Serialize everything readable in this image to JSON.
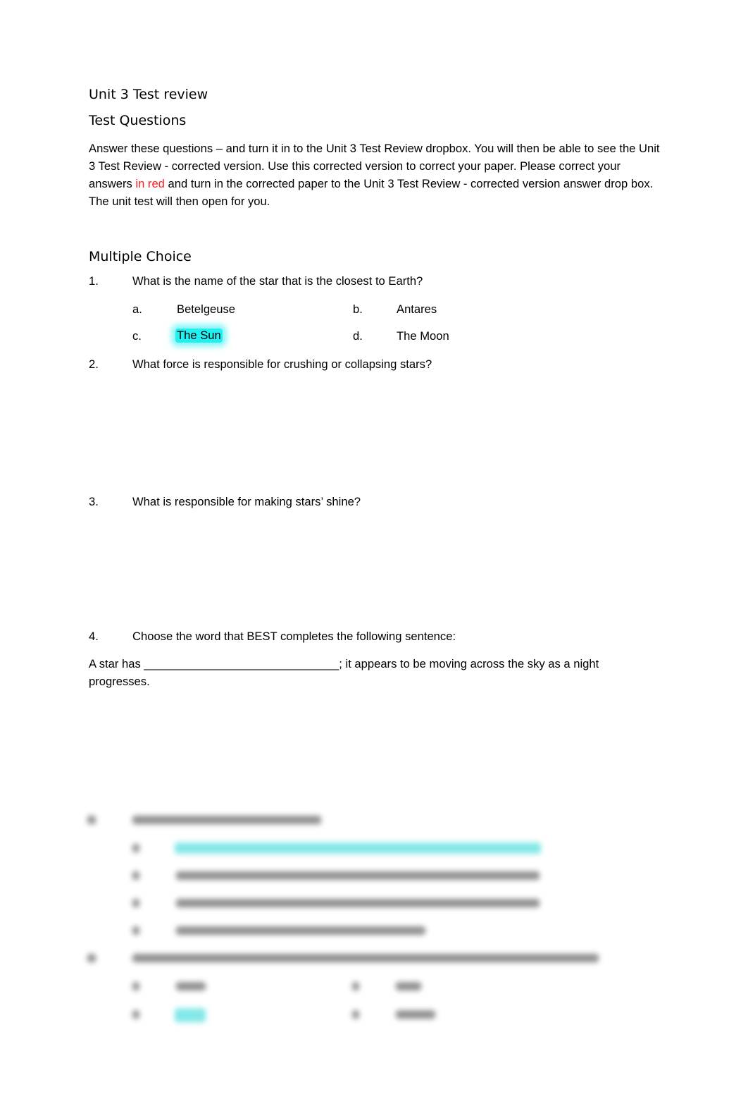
{
  "document": {
    "title": "Unit 3 Test review",
    "subtitle": "Test Questions",
    "instructions": {
      "part1": "Answer these questions – and turn it in to the Unit 3 Test Review dropbox. You will then be able to see the Unit 3 Test Review - corrected version.  Use this corrected version to correct your paper.  Please correct your answers ",
      "red_text": "in red",
      "part2": " and turn in the corrected paper to the Unit 3 Test Review - corrected version answer drop box.  The unit test will then open for you."
    },
    "section_heading": "Multiple Choice",
    "questions": [
      {
        "number": "1.",
        "text": "What is the name of the star that is the closest to Earth?",
        "options": [
          {
            "letter": "a.",
            "text": "Betelgeuse",
            "highlighted": false
          },
          {
            "letter": "b.",
            "text": "Antares",
            "highlighted": false
          },
          {
            "letter": "c.",
            "text": "The Sun",
            "highlighted": true
          },
          {
            "letter": "d.",
            "text": "The Moon",
            "highlighted": false
          }
        ]
      },
      {
        "number": "2.",
        "text": "What force is responsible for crushing or collapsing stars?"
      },
      {
        "number": "3.",
        "text": "What is responsible for making stars’ shine?"
      },
      {
        "number": "4.",
        "text": "Choose the word that BEST completes the following sentence:",
        "fill_in": {
          "before": "A star has ",
          "blank": "______________________________",
          "after": ";  it appears to be moving across the sky as a night",
          "continuation": "progresses."
        }
      }
    ],
    "highlight_color": "#22f0f0",
    "blurred_section_note": "Questions 5–6 are blurred and illegible"
  }
}
